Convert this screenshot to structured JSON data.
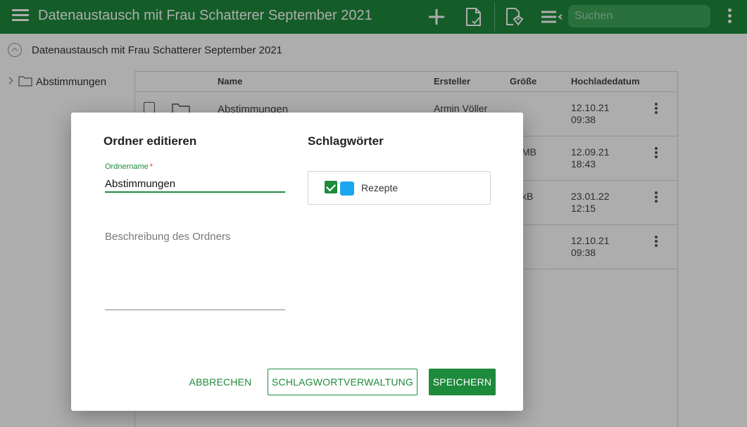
{
  "app": {
    "title": "Datenaustausch mit Frau Schatterer September 2021",
    "search_placeholder": "Suchen",
    "accent_color": "#1e8a3b"
  },
  "toolbar": {
    "icons": [
      "menu-icon",
      "add-icon",
      "document-check-icon",
      "tag-document-icon",
      "list-settings-icon",
      "more-vert-icon"
    ]
  },
  "breadcrumb": {
    "path": "Datenaustausch mit Frau Schatterer September 2021"
  },
  "tree": {
    "items": [
      {
        "label": "Abstimmungen"
      }
    ]
  },
  "table": {
    "headers": {
      "name": "Name",
      "creator": "Ersteller",
      "size": "Größe",
      "upload_date": "Hochladedatum"
    },
    "rows": [
      {
        "name": "Abstimmungen",
        "creator": "Armin Völler",
        "size": "",
        "date_line1": "12.10.21",
        "date_line2": "09:38"
      },
      {
        "name": "",
        "creator": "",
        "size": "MB",
        "date_line1": "12.09.21",
        "date_line2": "18:43"
      },
      {
        "name": "",
        "creator": "",
        "size": "kB",
        "date_line1": "23.01.22",
        "date_line2": "12:15"
      },
      {
        "name": "",
        "creator": "",
        "size": "",
        "date_line1": "12.10.21",
        "date_line2": "09:38"
      }
    ]
  },
  "dialog": {
    "title": "Ordner editieren",
    "name_label": "Ordnername",
    "required_marker": "*",
    "name_value": "Abstimmungen",
    "description_placeholder": "Beschreibung des Ordners",
    "tags_title": "Schlagwörter",
    "tags": [
      {
        "label": "Rezepte",
        "checked": true,
        "color": "#1ba7f0"
      }
    ],
    "cancel_label": "ABBRECHEN",
    "tags_manage_label": "SCHLAGWORTVERWALTUNG",
    "save_label": "SPEICHERN"
  }
}
